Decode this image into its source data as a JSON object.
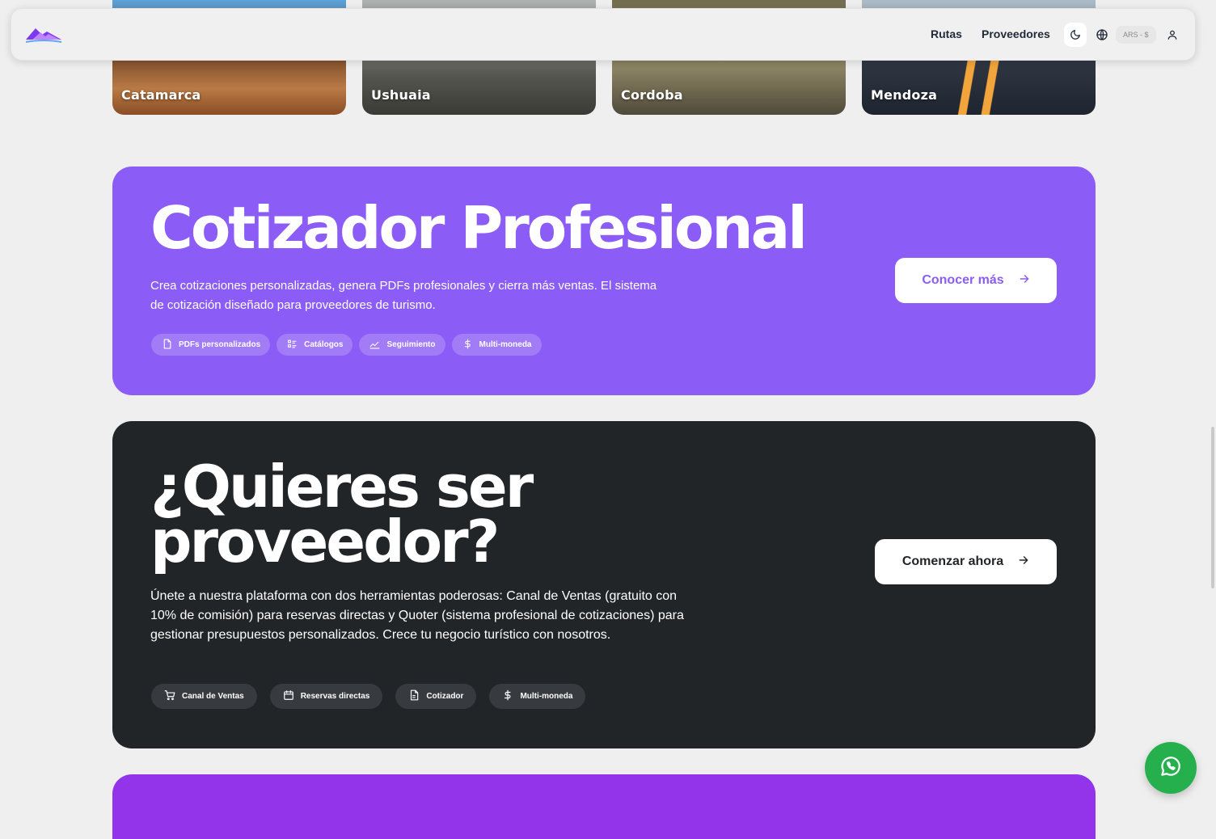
{
  "destinations": [
    {
      "name": "Catamarca"
    },
    {
      "name": "Ushuaia"
    },
    {
      "name": "Cordoba"
    },
    {
      "name": "Mendoza"
    }
  ],
  "nav": {
    "routes": "Rutas",
    "providers": "Proveedores",
    "currency": "ARS - $",
    "icons": [
      "moon-icon",
      "globe-icon",
      "user-icon"
    ]
  },
  "quoter": {
    "title": "Cotizador Profesional",
    "description": "Crea cotizaciones personalizadas, genera PDFs profesionales y cierra más ventas. El sistema de cotización diseñado para proveedores de turismo.",
    "chips": [
      "PDFs personalizados",
      "Catálogos",
      "Seguimiento",
      "Multi-moneda"
    ],
    "cta": "Conocer más",
    "color": "#8b5cf6"
  },
  "provider": {
    "title_line1": "¿Quieres ser",
    "title_line2": "proveedor?",
    "description": "Únete a nuestra plataforma con dos herramientas poderosas: Canal de Ventas (gratuito con 10% de comisión) para reservas directas y Quoter (sistema profesional de cotizaciones) para gestionar presupuestos personalizados. Crece tu negocio turístico con nosotros.",
    "chips": [
      "Canal de Ventas",
      "Reservas directas",
      "Cotizador",
      "Multi-moneda"
    ],
    "cta": "Comenzar ahora",
    "color": "#222528"
  }
}
